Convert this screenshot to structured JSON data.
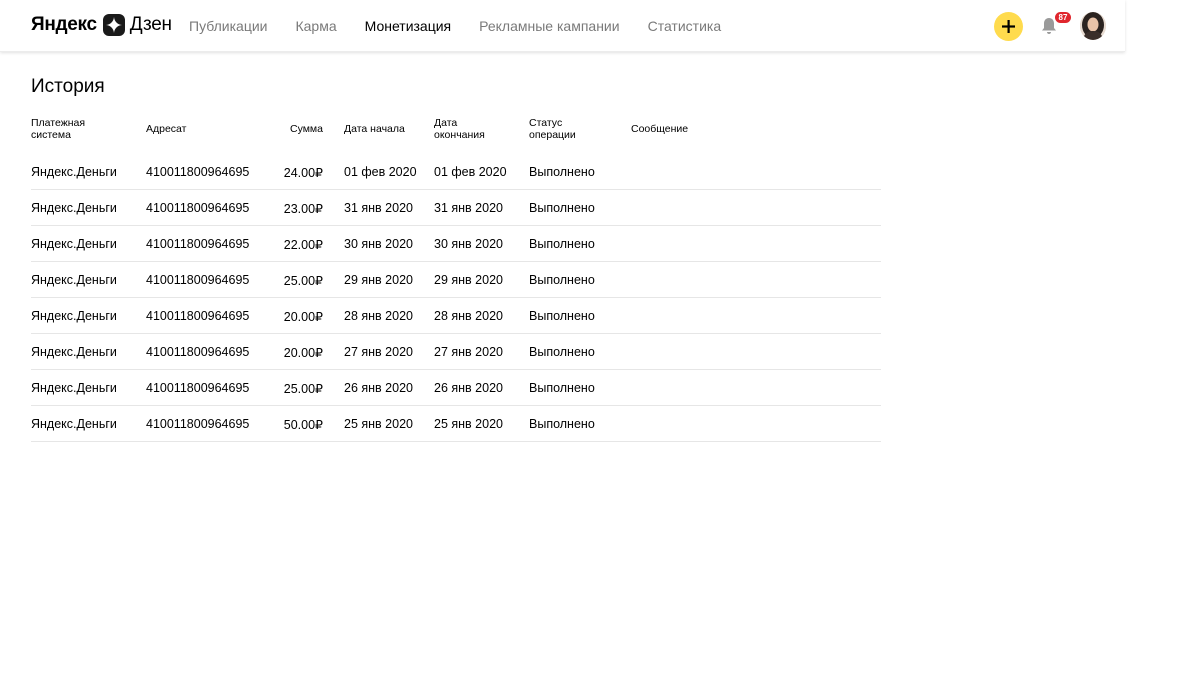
{
  "header": {
    "logo": {
      "part1": "Яндекс",
      "part2": "Дзен"
    },
    "nav": [
      {
        "label": "Публикации",
        "active": false
      },
      {
        "label": "Карма",
        "active": false
      },
      {
        "label": "Монетизация",
        "active": true
      },
      {
        "label": "Рекламные кампании",
        "active": false
      },
      {
        "label": "Статистика",
        "active": false
      }
    ],
    "add_button_icon": "plus-icon",
    "notifications": {
      "icon": "bell-icon",
      "count": "87"
    },
    "avatar_icon": "user-avatar"
  },
  "main": {
    "title": "История",
    "columns": {
      "system": "Платежная система",
      "recipient": "Адресат",
      "sum": "Сумма",
      "start": "Дата начала",
      "end": "Дата окончания",
      "status": "Статус операции",
      "message": "Сообщение"
    },
    "rows": [
      {
        "system": "Яндекс.Деньги",
        "recipient": "410011800964695",
        "sum": "24.00₽",
        "start": "01 фев 2020",
        "end": "01 фев 2020",
        "status": "Выполнено",
        "message": ""
      },
      {
        "system": "Яндекс.Деньги",
        "recipient": "410011800964695",
        "sum": "23.00₽",
        "start": "31 янв 2020",
        "end": "31 янв 2020",
        "status": "Выполнено",
        "message": ""
      },
      {
        "system": "Яндекс.Деньги",
        "recipient": "410011800964695",
        "sum": "22.00₽",
        "start": "30 янв 2020",
        "end": "30 янв 2020",
        "status": "Выполнено",
        "message": ""
      },
      {
        "system": "Яндекс.Деньги",
        "recipient": "410011800964695",
        "sum": "25.00₽",
        "start": "29 янв 2020",
        "end": "29 янв 2020",
        "status": "Выполнено",
        "message": ""
      },
      {
        "system": "Яндекс.Деньги",
        "recipient": "410011800964695",
        "sum": "20.00₽",
        "start": "28 янв 2020",
        "end": "28 янв 2020",
        "status": "Выполнено",
        "message": ""
      },
      {
        "system": "Яндекс.Деньги",
        "recipient": "410011800964695",
        "sum": "20.00₽",
        "start": "27 янв 2020",
        "end": "27 янв 2020",
        "status": "Выполнено",
        "message": ""
      },
      {
        "system": "Яндекс.Деньги",
        "recipient": "410011800964695",
        "sum": "25.00₽",
        "start": "26 янв 2020",
        "end": "26 янв 2020",
        "status": "Выполнено",
        "message": ""
      },
      {
        "system": "Яндекс.Деньги",
        "recipient": "410011800964695",
        "sum": "50.00₽",
        "start": "25 янв 2020",
        "end": "25 янв 2020",
        "status": "Выполнено",
        "message": ""
      }
    ]
  },
  "colors": {
    "accent_yellow": "#ffdb4d",
    "badge_red": "#e0262d",
    "nav_inactive": "#7a7a7a",
    "divider": "#e6e6e6"
  }
}
